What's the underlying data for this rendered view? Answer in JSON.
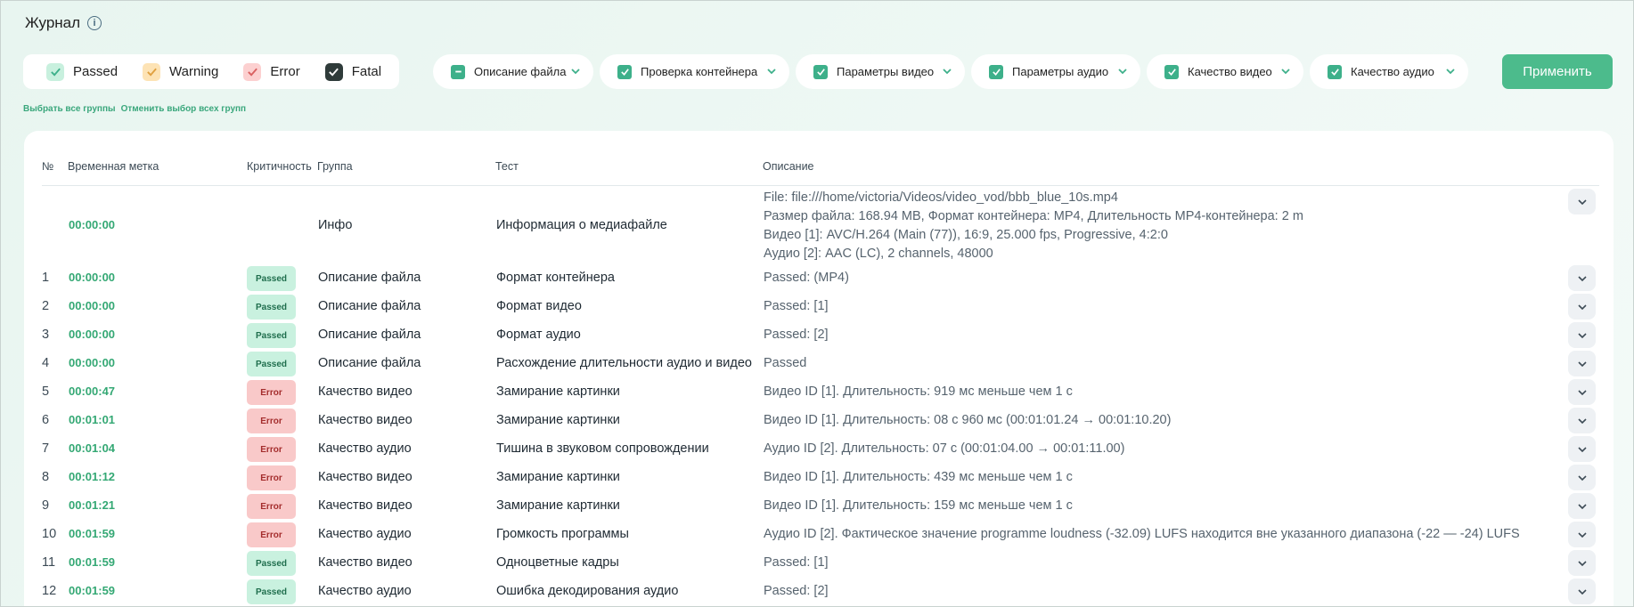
{
  "header": {
    "title": "Журнал"
  },
  "severity_filter": [
    {
      "label": "Passed",
      "color": "#3db08a"
    },
    {
      "label": "Warning",
      "color": "#e0a040"
    },
    {
      "label": "Error",
      "color": "#d96060"
    },
    {
      "label": "Fatal",
      "color": "#ffffff"
    }
  ],
  "groups": [
    {
      "label": "Описание файла"
    },
    {
      "label": "Проверка контейнера"
    },
    {
      "label": "Параметры видео"
    },
    {
      "label": "Параметры аудио"
    },
    {
      "label": "Качество видео"
    },
    {
      "label": "Качество аудио"
    }
  ],
  "apply_label": "Применить",
  "links": {
    "select_all": "Выбрать все группы",
    "deselect_all": "Отменить выбор всех групп"
  },
  "columns": {
    "num": "№",
    "timestamp": "Временная метка",
    "severity": "Критичность",
    "group": "Группа",
    "test": "Тест",
    "description": "Описание"
  },
  "info_row": {
    "time": "00:00:00",
    "group": "Инфо",
    "test": "Информация о медиафайле",
    "lines": [
      "File: file:///home/victoria/Videos/video_vod/bbb_blue_10s.mp4",
      "Размер файла: 168.94 MB, Формат контейнера: MP4, Длительность MP4-контейнера: 2 m",
      "Видео [1]: AVC/H.264 (Main (77)), 16:9, 25.000 fps, Progressive, 4:2:0",
      "Аудио [2]: AAC (LC), 2 channels, 48000"
    ]
  },
  "rows": [
    {
      "num": "1",
      "time": "00:00:00",
      "sev": "Passed",
      "group": "Описание файла",
      "test": "Формат контейнера",
      "desc": "Passed: (MP4)"
    },
    {
      "num": "2",
      "time": "00:00:00",
      "sev": "Passed",
      "group": "Описание файла",
      "test": "Формат видео",
      "desc": "Passed: [1]"
    },
    {
      "num": "3",
      "time": "00:00:00",
      "sev": "Passed",
      "group": "Описание файла",
      "test": "Формат аудио",
      "desc": "Passed: [2]"
    },
    {
      "num": "4",
      "time": "00:00:00",
      "sev": "Passed",
      "group": "Описание файла",
      "test": "Расхождение длительности аудио и видео",
      "desc": "Passed"
    },
    {
      "num": "5",
      "time": "00:00:47",
      "sev": "Error",
      "group": "Качество видео",
      "test": "Замирание картинки",
      "desc": "Видео ID [1]. Длительность: 919 мс меньше чем 1 с"
    },
    {
      "num": "6",
      "time": "00:01:01",
      "sev": "Error",
      "group": "Качество видео",
      "test": "Замирание картинки",
      "desc": "Видео ID [1]. Длительность: 08 с 960 мс (00:01:01.24 → 00:01:10.20)"
    },
    {
      "num": "7",
      "time": "00:01:04",
      "sev": "Error",
      "group": "Качество аудио",
      "test": "Тишина в звуковом сопровождении",
      "desc": "Аудио ID [2]. Длительность: 07 с (00:01:04.00 → 00:01:11.00)"
    },
    {
      "num": "8",
      "time": "00:01:12",
      "sev": "Error",
      "group": "Качество видео",
      "test": "Замирание картинки",
      "desc": "Видео ID [1]. Длительность: 439 мс меньше чем 1 с"
    },
    {
      "num": "9",
      "time": "00:01:21",
      "sev": "Error",
      "group": "Качество видео",
      "test": "Замирание картинки",
      "desc": "Видео ID [1]. Длительность: 159 мс меньше чем 1 с"
    },
    {
      "num": "10",
      "time": "00:01:59",
      "sev": "Error",
      "group": "Качество аудио",
      "test": "Громкость программы",
      "desc": "Аудио ID [2]. Фактическое значение programme loudness (-32.09) LUFS находится вне указанного диапазона (-22 — -24) LUFS"
    },
    {
      "num": "11",
      "time": "00:01:59",
      "sev": "Passed",
      "group": "Качество видео",
      "test": "Одноцветные кадры",
      "desc": "Passed: [1]"
    },
    {
      "num": "12",
      "time": "00:01:59",
      "sev": "Passed",
      "group": "Качество аудио",
      "test": "Ошибка декодирования аудио",
      "desc": "Passed: [2]"
    }
  ]
}
